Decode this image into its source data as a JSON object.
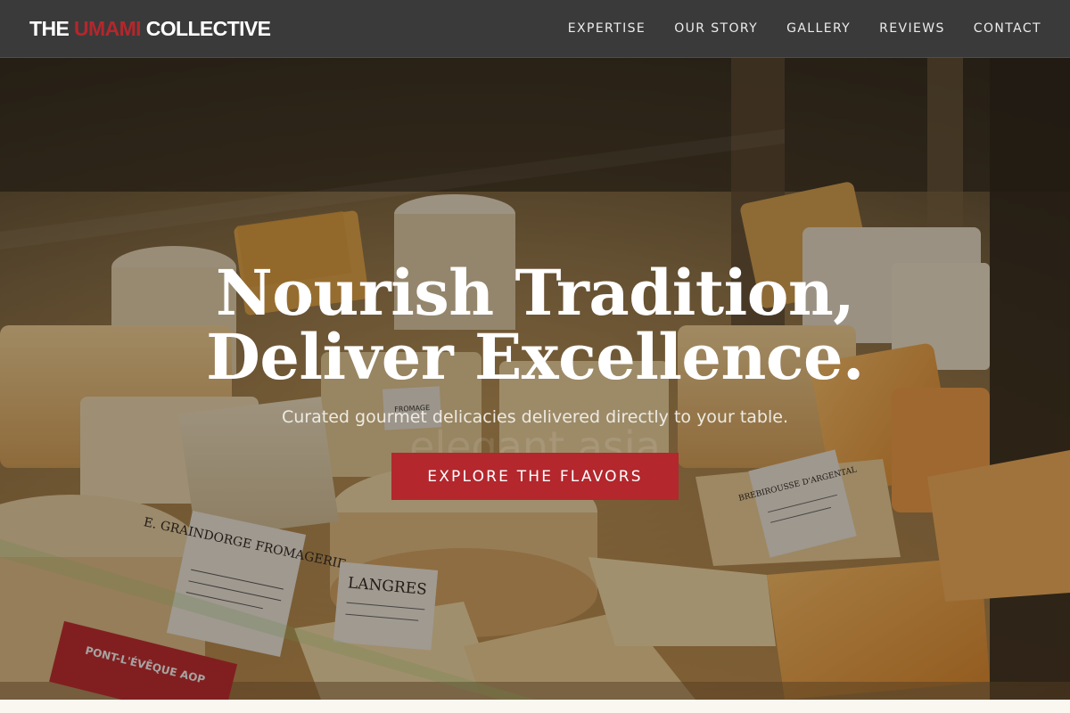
{
  "brand": {
    "part1": "THE ",
    "accent": "UMAMI",
    "part2": " COLLECTIVE"
  },
  "nav": {
    "items": [
      {
        "label": "EXPERTISE"
      },
      {
        "label": "OUR STORY"
      },
      {
        "label": "GALLERY"
      },
      {
        "label": "REVIEWS"
      },
      {
        "label": "CONTACT"
      }
    ]
  },
  "hero": {
    "headline_line1": "Nourish Tradition,",
    "headline_line2": "Deliver Excellence.",
    "subheadline": "Curated gourmet delicacies delivered directly to your table.",
    "cta_label": "EXPLORE THE FLAVORS",
    "watermark": "elegant.asia",
    "image_labels": {
      "shop": "E. GRAINDORGE FROMAGERIE",
      "langres": "LANGRES",
      "brebi": "BREBIROUSSE D'ARGENTAL",
      "pont": "PONT-L'ÉVÊQUE AOP",
      "fromage": "FROMAGE"
    }
  },
  "colors": {
    "nav_bg": "#3a3a3a",
    "accent": "#b3272d",
    "text_light": "#ffffff"
  }
}
